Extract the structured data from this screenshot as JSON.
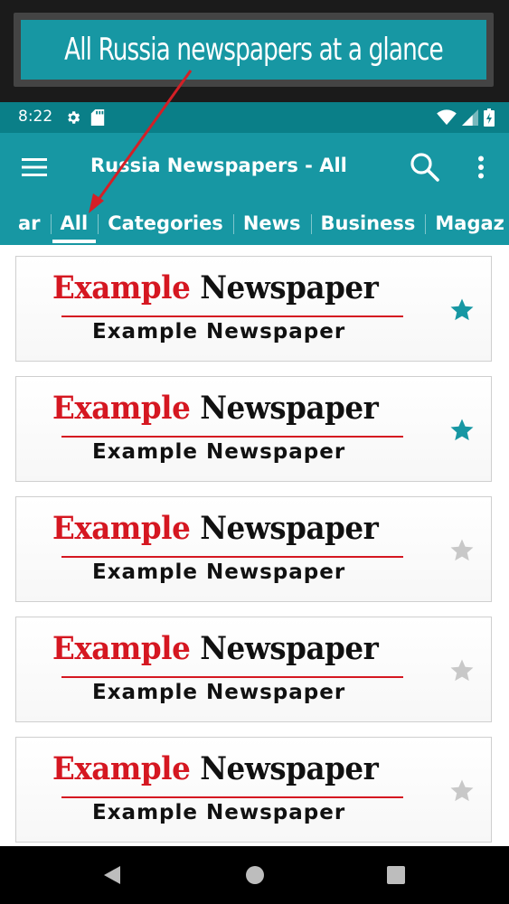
{
  "promo": {
    "caption": "All Russia newspapers at a glance"
  },
  "status": {
    "time": "8:22"
  },
  "appbar": {
    "title": "Russia Newspapers - All"
  },
  "tabs": [
    {
      "label": "ar",
      "active": false
    },
    {
      "label": "All",
      "active": true
    },
    {
      "label": "Categories",
      "active": false
    },
    {
      "label": "News",
      "active": false
    },
    {
      "label": "Business",
      "active": false
    },
    {
      "label": "Magaz",
      "active": false
    }
  ],
  "cards": [
    {
      "title_red": "Example",
      "title_black": "Newspaper",
      "subtitle": "Example Newspaper",
      "favorite": true
    },
    {
      "title_red": "Example",
      "title_black": "Newspaper",
      "subtitle": "Example Newspaper",
      "favorite": true
    },
    {
      "title_red": "Example",
      "title_black": "Newspaper",
      "subtitle": "Example Newspaper",
      "favorite": false
    },
    {
      "title_red": "Example",
      "title_black": "Newspaper",
      "subtitle": "Example Newspaper",
      "favorite": false
    },
    {
      "title_red": "Example",
      "title_black": "Newspaper",
      "subtitle": "Example Newspaper",
      "favorite": false
    }
  ],
  "colors": {
    "accent": "#1797a3",
    "status_bar": "#0a7f88",
    "star_on": "#1797a3",
    "star_off": "#c8c8c8",
    "logo_red": "#d51721",
    "arrow": "#d41f26"
  },
  "icons": {
    "status_left": [
      "gear-icon",
      "sd-card-icon"
    ],
    "status_right": [
      "wifi-icon",
      "signal-icon",
      "battery-icon"
    ],
    "appbar": [
      "hamburger-menu-icon",
      "search-icon",
      "more-vert-icon"
    ],
    "nav": [
      "back-icon",
      "home-icon",
      "recents-icon"
    ]
  }
}
